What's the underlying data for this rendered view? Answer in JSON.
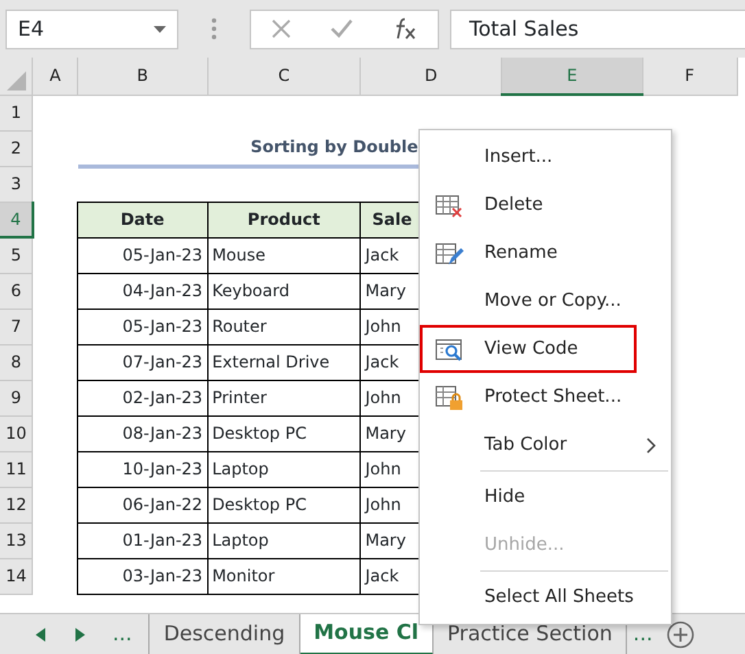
{
  "name_box": "E4",
  "formula_bar": {
    "value": "Total Sales"
  },
  "columns": [
    {
      "label": "A",
      "selected": false
    },
    {
      "label": "B",
      "selected": false
    },
    {
      "label": "C",
      "selected": false
    },
    {
      "label": "D",
      "selected": false
    },
    {
      "label": "E",
      "selected": true
    },
    {
      "label": "F",
      "selected": false
    }
  ],
  "rows": [
    {
      "label": "1",
      "selected": false
    },
    {
      "label": "2",
      "selected": false
    },
    {
      "label": "3",
      "selected": false
    },
    {
      "label": "4",
      "selected": true
    },
    {
      "label": "5",
      "selected": false
    },
    {
      "label": "6",
      "selected": false
    },
    {
      "label": "7",
      "selected": false
    },
    {
      "label": "8",
      "selected": false
    },
    {
      "label": "9",
      "selected": false
    },
    {
      "label": "10",
      "selected": false
    },
    {
      "label": "11",
      "selected": false
    },
    {
      "label": "12",
      "selected": false
    },
    {
      "label": "13",
      "selected": false
    },
    {
      "label": "14",
      "selected": false
    }
  ],
  "title": "Sorting by Double",
  "table": {
    "columns": [
      "Date",
      "Product",
      "Sale"
    ],
    "rows": [
      [
        "05-Jan-23",
        "Mouse",
        "Jack"
      ],
      [
        "04-Jan-23",
        "Keyboard",
        "Mary"
      ],
      [
        "05-Jan-23",
        "Router",
        "John"
      ],
      [
        "07-Jan-23",
        "External Drive",
        "Jack"
      ],
      [
        "02-Jan-23",
        "Printer",
        "John"
      ],
      [
        "08-Jan-23",
        "Desktop PC",
        "Mary"
      ],
      [
        "10-Jan-23",
        "Laptop",
        "John"
      ],
      [
        "06-Jan-22",
        "Desktop PC",
        "John"
      ],
      [
        "01-Jan-23",
        "Laptop",
        "Mary"
      ],
      [
        "03-Jan-23",
        "Monitor",
        "Jack"
      ]
    ]
  },
  "sheet_tabs": {
    "overflow_left": "...",
    "tabs": [
      {
        "label": "Descending",
        "selected": false
      },
      {
        "label": "Mouse Cl",
        "selected": true
      },
      {
        "label": "Practice Section",
        "selected": false
      }
    ],
    "overflow_right": "..."
  },
  "context_menu": [
    {
      "kind": "item",
      "label": "Insert...",
      "disabled": false,
      "highlighted": false,
      "submenu": false
    },
    {
      "kind": "item",
      "label": "Delete",
      "disabled": false,
      "highlighted": false,
      "submenu": false
    },
    {
      "kind": "item",
      "label": "Rename",
      "disabled": false,
      "highlighted": false,
      "submenu": false
    },
    {
      "kind": "item",
      "label": "Move or Copy...",
      "disabled": false,
      "highlighted": false,
      "submenu": false
    },
    {
      "kind": "item",
      "label": "View Code",
      "disabled": false,
      "highlighted": true,
      "submenu": false
    },
    {
      "kind": "item",
      "label": "Protect Sheet...",
      "disabled": false,
      "highlighted": false,
      "submenu": false
    },
    {
      "kind": "item",
      "label": "Tab Color",
      "disabled": false,
      "highlighted": false,
      "submenu": true
    },
    {
      "kind": "separator"
    },
    {
      "kind": "item",
      "label": "Hide",
      "disabled": false,
      "highlighted": false,
      "submenu": false
    },
    {
      "kind": "item",
      "label": "Unhide...",
      "disabled": true,
      "highlighted": false,
      "submenu": false
    },
    {
      "kind": "separator"
    },
    {
      "kind": "item",
      "label": "Select All Sheets",
      "disabled": false,
      "highlighted": false,
      "submenu": false
    }
  ]
}
